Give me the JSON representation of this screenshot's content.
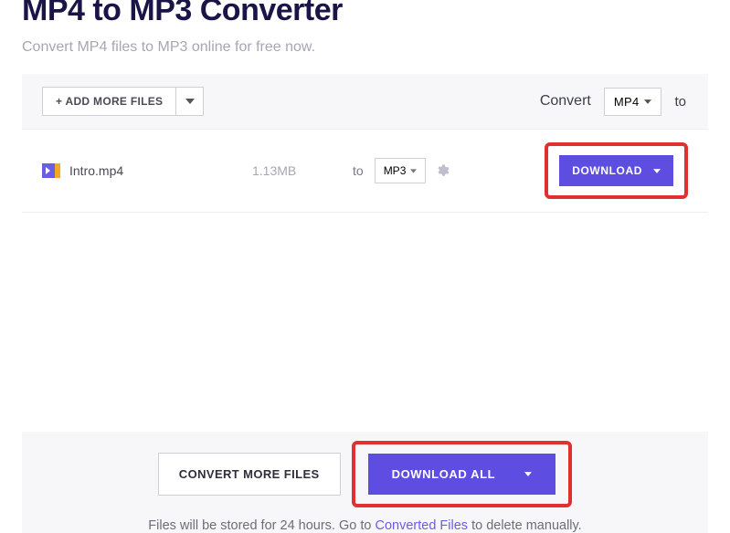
{
  "header": {
    "title": "MP4 to MP3 Converter",
    "subtitle": "Convert MP4 files to MP3 online for free now."
  },
  "toolbar": {
    "add_more_label": "+ ADD MORE FILES",
    "convert_label": "Convert",
    "source_format": "MP4",
    "to_label": "to"
  },
  "files": [
    {
      "name": "Intro.mp4",
      "size": "1.13MB",
      "to_label": "to",
      "target_format": "MP3",
      "download_label": "DOWNLOAD"
    }
  ],
  "footer": {
    "convert_more_label": "CONVERT MORE FILES",
    "download_all_label": "DOWNLOAD ALL",
    "note_prefix": "Files will be stored for 24 hours. Go to ",
    "note_link": "Converted Files",
    "note_suffix": " to delete manually."
  }
}
